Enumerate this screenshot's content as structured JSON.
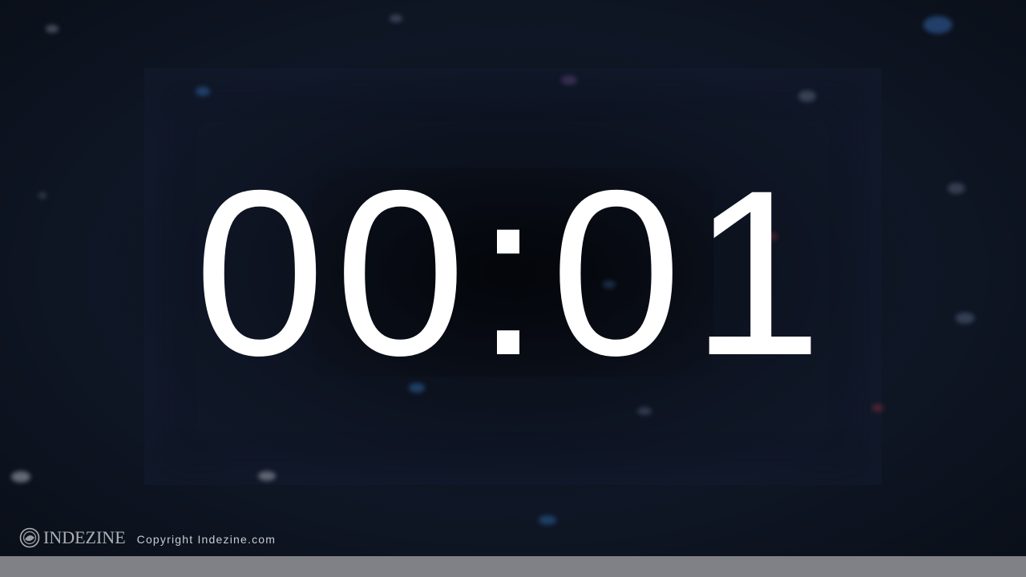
{
  "timer": {
    "display": "00:01"
  },
  "footer": {
    "logo_text": "INDEZINE",
    "copyright": "Copyright Indezine.com",
    "logo_icon": "indezine-logo-icon"
  },
  "colors": {
    "background": "#0f1726",
    "timer_text": "#ffffff",
    "bottom_bar": "#808187"
  }
}
